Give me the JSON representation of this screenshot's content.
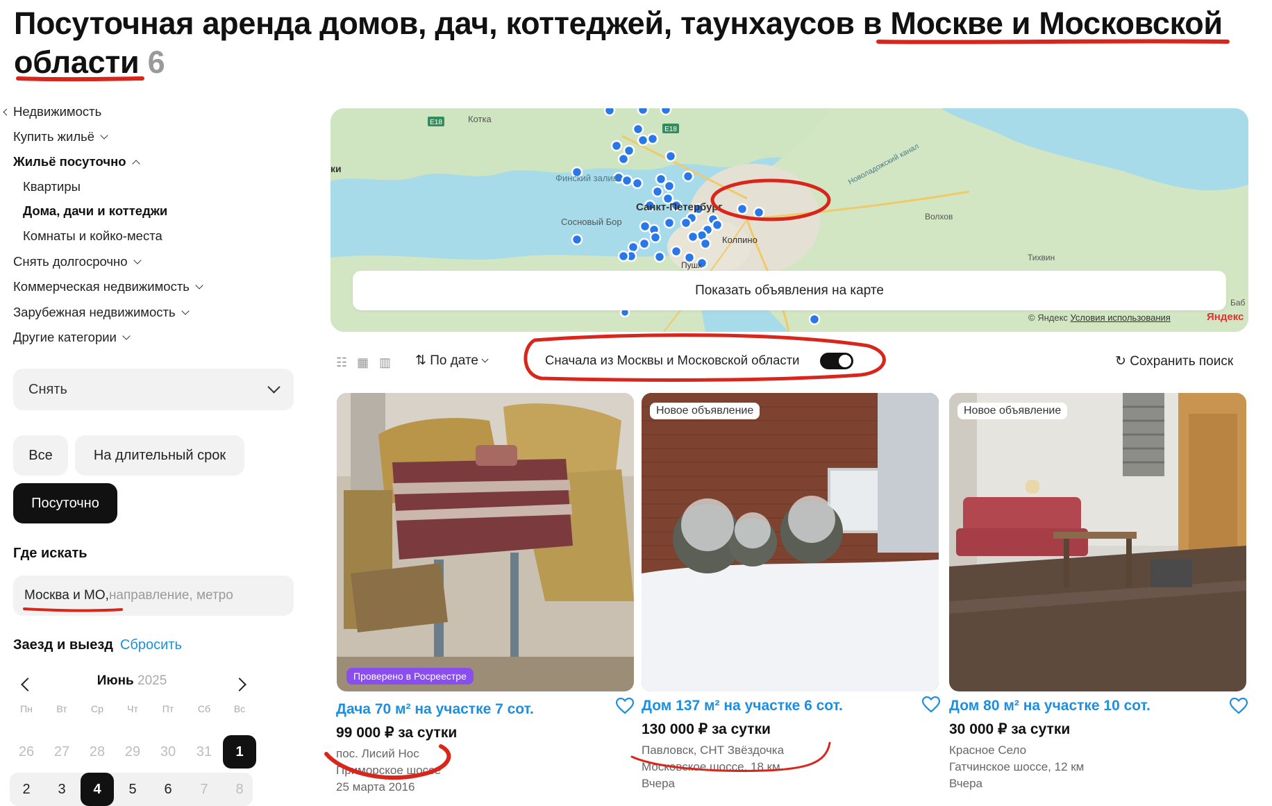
{
  "title": {
    "text": "Посуточная аренда домов, дач, коттеджей, таунхаусов в Москве и Московской области",
    "count": "6"
  },
  "nav": {
    "back": "Недвижимость",
    "buy": "Купить жильё",
    "daily": "Жильё посуточно",
    "sub1": "Квартиры",
    "sub2": "Дома, дачи и коттеджи",
    "sub3": "Комнаты и койко-места",
    "longterm": "Снять долгосрочно",
    "commercial": "Коммерческая недвижимость",
    "abroad": "Зарубежная недвижимость",
    "other": "Другие категории"
  },
  "filters": {
    "deal_select": "Снять",
    "chip_all": "Все",
    "chip_long": "На длительный срок",
    "chip_daily": "Посуточно",
    "where_label": "Где искать",
    "location_value": "Москва и МО,",
    "location_placeholder": " направление, метро",
    "dates_label": "Заезд и выезд",
    "reset": "Сбросить"
  },
  "calendar": {
    "month": "Июнь",
    "year": "2025",
    "dow": [
      "Пн",
      "Вт",
      "Ср",
      "Чт",
      "Пт",
      "Сб",
      "Вс"
    ],
    "row1": [
      "26",
      "27",
      "28",
      "29",
      "30",
      "31",
      "1"
    ],
    "row2": [
      "2",
      "3",
      "4",
      "5",
      "6",
      "7",
      "8"
    ]
  },
  "map": {
    "labels": {
      "kotka": "Котка",
      "gulf": "Финский залив",
      "spb": "Санкт-Петербург",
      "sosnovy": "Сосновый Бор",
      "kolpino": "Колпино",
      "volkhov": "Волхов",
      "tikhvin": "Тихвин",
      "canal": "Новоладожский канал",
      "pushkin": "Пушк",
      "e18": "E18",
      "e18b": "E18",
      "ki": "ки",
      "bab": "Баб"
    },
    "show_button": "Показать объявления на карте",
    "copyright": "© Яндекс",
    "terms": "Условия использования",
    "brand": "Яндекс"
  },
  "toolbar": {
    "sort": "По дате",
    "toggle_label": "Сначала из Москвы и Московской области",
    "toggle_on": true,
    "save_search": "Сохранить поиск"
  },
  "cards": [
    {
      "badge": "Проверено в Росреестре",
      "title": "Дача 70 м² на участке 7 сот.",
      "price": "99 000 ₽ за сутки",
      "line1": "пос. Лисий Нос",
      "line2": "Приморское шоссе",
      "line3": "25 марта 2016"
    },
    {
      "badge": "Новое объявление",
      "title": "Дом 137 м² на участке 6 сот.",
      "price": "130 000 ₽ за сутки",
      "line1": "Павловск, СНТ Звёздочка",
      "line2": "Московское шоссе, 18 км",
      "line3": "Вчера"
    },
    {
      "badge": "Новое объявление",
      "title": "Дом 80 м² на участке 10 сот.",
      "price": "30 000 ₽ за сутки",
      "line1": "Красное Село",
      "line2": "Гатчинское шоссе, 12 км",
      "line3": "Вчера"
    }
  ],
  "colors": {
    "accent": "#1c8fe0",
    "annotation": "#d9261c",
    "dark": "#111111",
    "badge_purple": "#8a4df0"
  }
}
